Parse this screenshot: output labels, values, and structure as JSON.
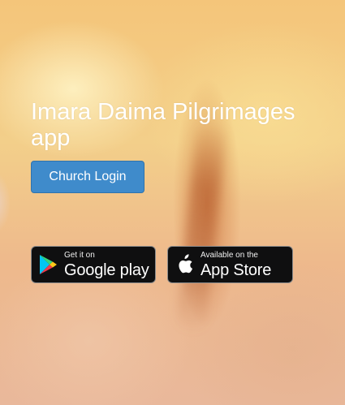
{
  "hero": {
    "title": "Imara Daima Pilgrimages app",
    "login_label": "Church Login"
  },
  "badges": {
    "google_play": {
      "small": "Get it on",
      "big": "Google play",
      "icon": "google-play-icon"
    },
    "app_store": {
      "small": "Available on the",
      "big": "App Store",
      "icon": "apple-icon"
    }
  },
  "colors": {
    "button": "#3f8bcb",
    "badge_bg": "#0f0f10",
    "background_warm": "#f3cf8a"
  }
}
